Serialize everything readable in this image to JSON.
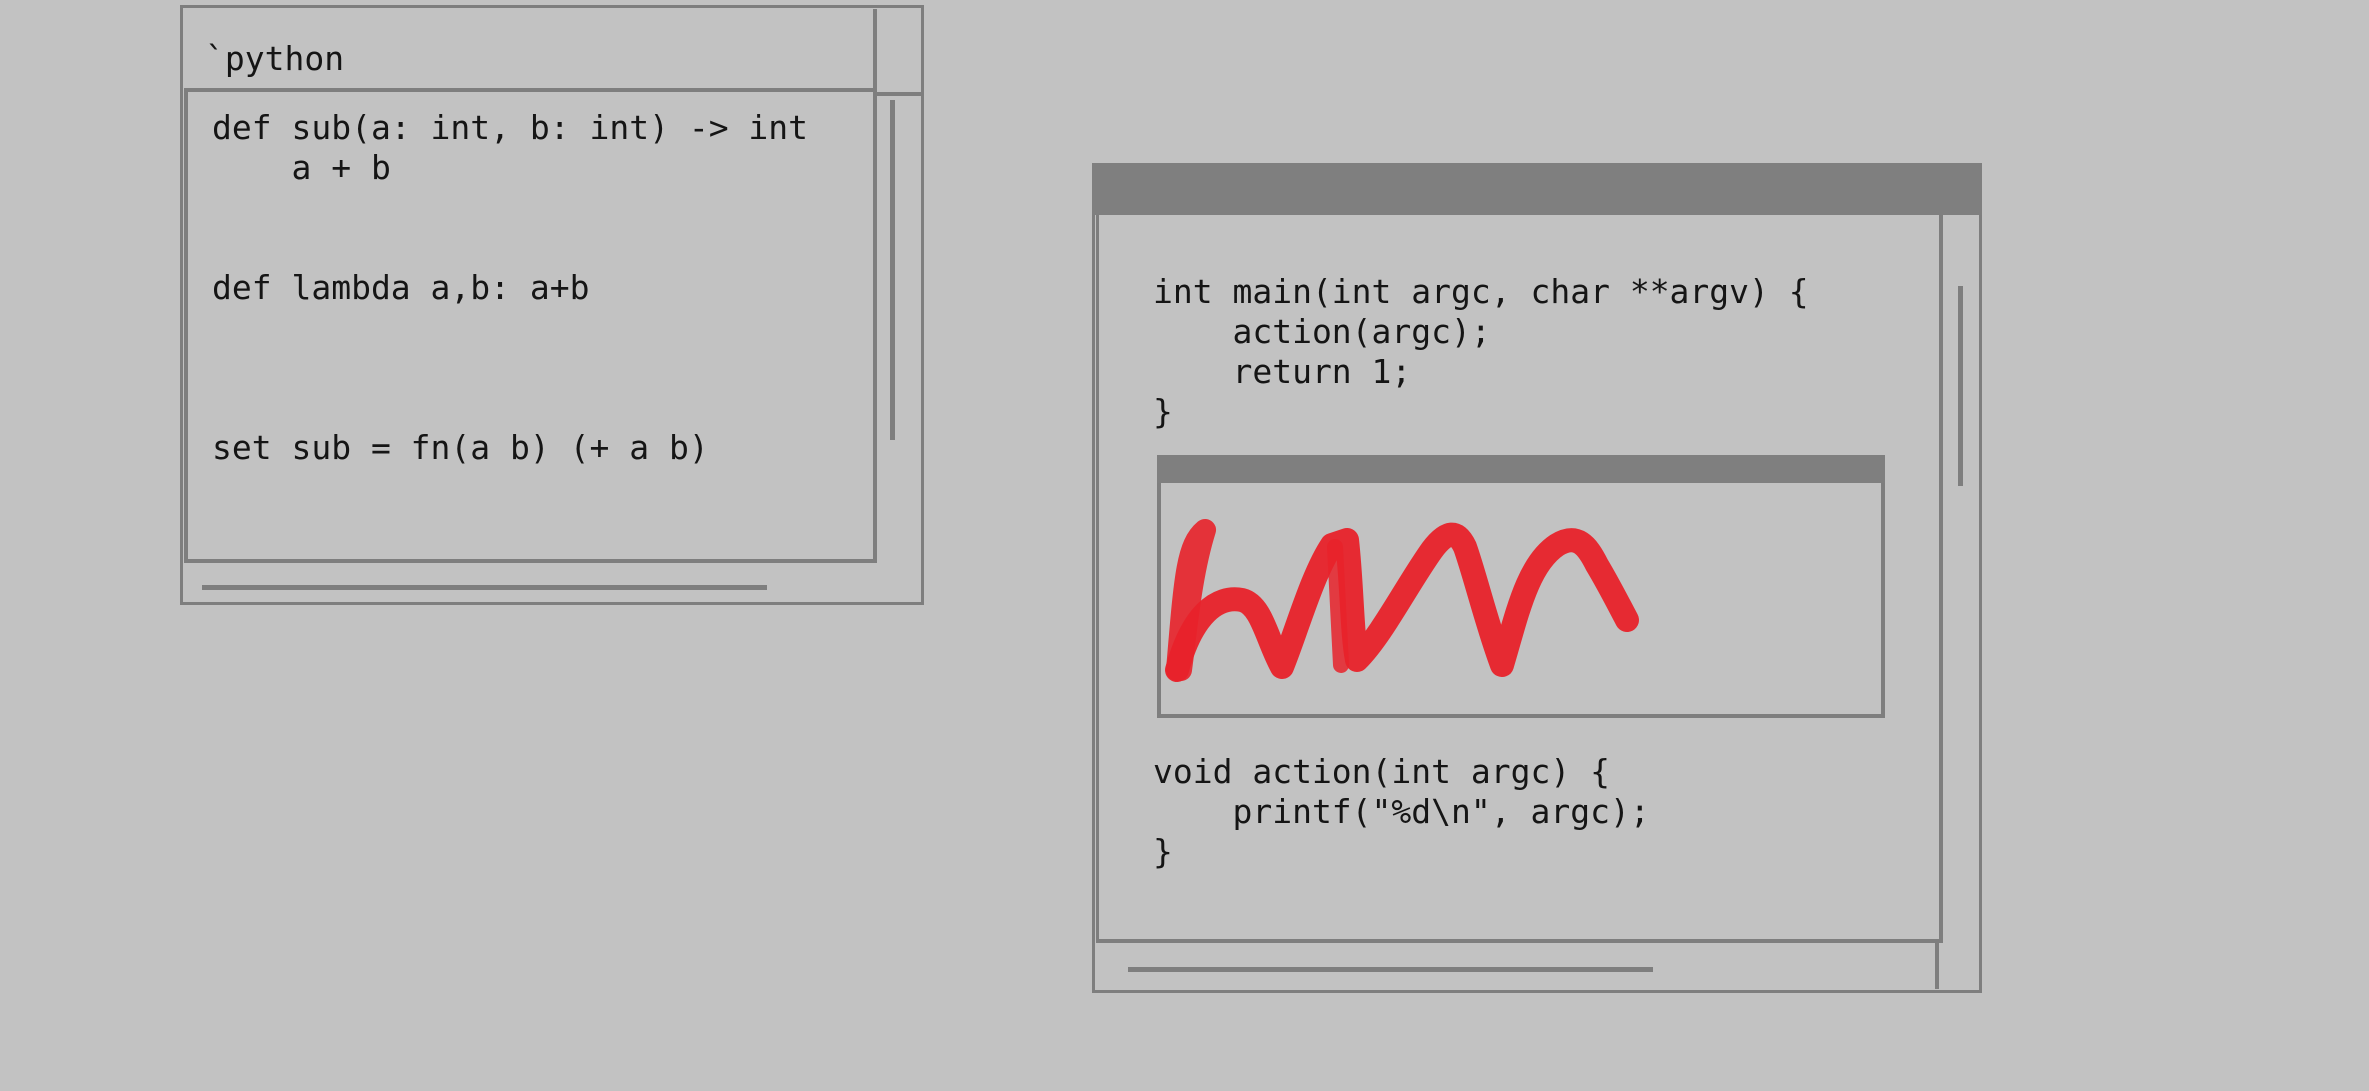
{
  "python_window": {
    "title": "`python",
    "code_lines": [
      "def sub(a: int, b: int) -> int",
      "    a + b",
      "def lambda a,b: a+b",
      "set sub = fn(a b) (+ a b)"
    ]
  },
  "c_window": {
    "code_lines_top": [
      "int main(int argc, char **argv) {",
      "    action(argc);",
      "    return 1;",
      "}"
    ],
    "code_lines_bottom": [
      "void action(int argc) {",
      "    printf(\"%d\\n\", argc);",
      "}"
    ],
    "drawing": {
      "stroke_color": "#e8222a",
      "content": "red-scribble-icon"
    }
  },
  "colors": {
    "background": "#c2c2c2",
    "border": "#7e7e7e",
    "titlebar": "#7f7f7f",
    "text": "#151515"
  }
}
